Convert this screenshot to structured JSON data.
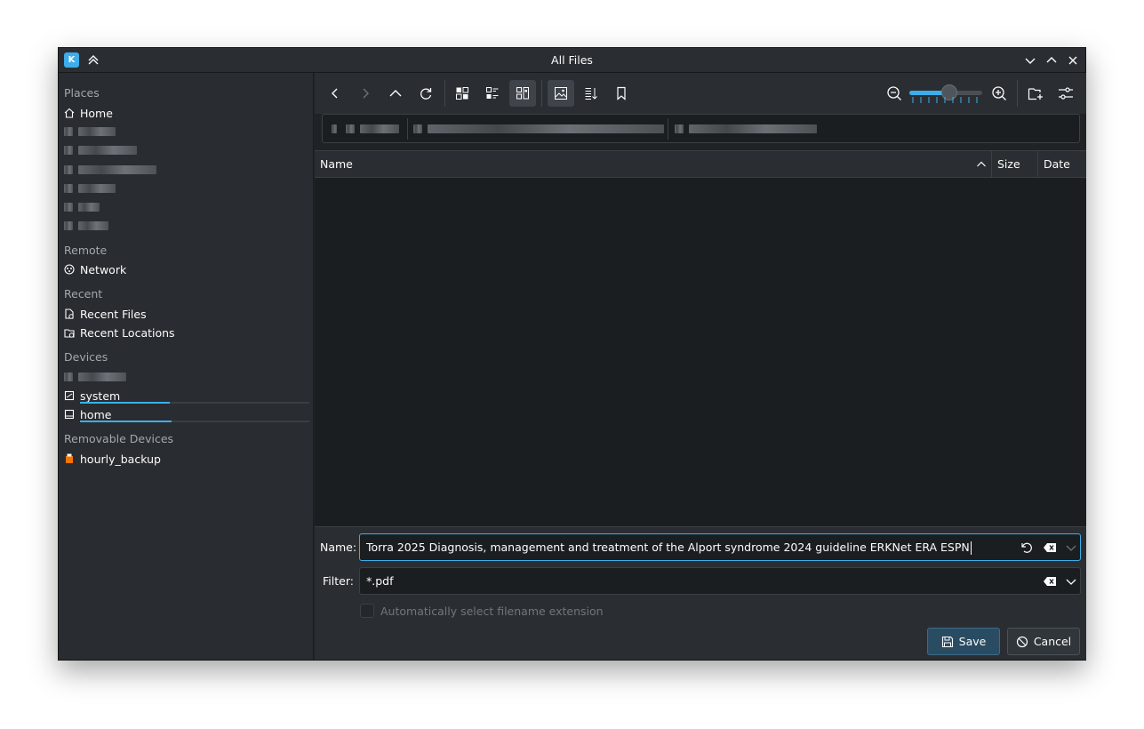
{
  "window": {
    "title": "All Files"
  },
  "colors": {
    "accent": "#3daee9",
    "window_bg": "#202326",
    "panel_bg": "#2a2e32"
  },
  "sidebar": {
    "sections": {
      "places": "Places",
      "remote": "Remote",
      "recent": "Recent",
      "devices": "Devices",
      "removable": "Removable Devices"
    },
    "places": [
      {
        "label": "Home",
        "icon": "home-icon"
      }
    ],
    "remote": [
      {
        "label": "Network",
        "icon": "network-icon"
      }
    ],
    "recent": [
      {
        "label": "Recent Files",
        "icon": "recent-files-icon"
      },
      {
        "label": "Recent Locations",
        "icon": "recent-locations-icon"
      }
    ],
    "devices": [
      {
        "label": "system",
        "icon": "drive-icon",
        "usage": 0.39
      },
      {
        "label": "home",
        "icon": "drive-icon",
        "usage": 0.4
      }
    ],
    "removable": [
      {
        "label": "hourly_backup",
        "icon": "usb-drive-icon"
      }
    ]
  },
  "file_list": {
    "columns": {
      "name": "Name",
      "size": "Size",
      "date": "Date"
    },
    "sort": "name-ascending"
  },
  "zoom": {
    "level": 0.55
  },
  "form": {
    "name_label": "Name:",
    "name_value": "Torra 2025 Diagnosis, management and treatment of the Alport syndrome 2024 guideline ERKNet ERA ESPN",
    "filter_label": "Filter:",
    "filter_value": "*.pdf",
    "auto_ext_label": "Automatically select filename extension",
    "save_label": "Save",
    "cancel_label": "Cancel"
  }
}
